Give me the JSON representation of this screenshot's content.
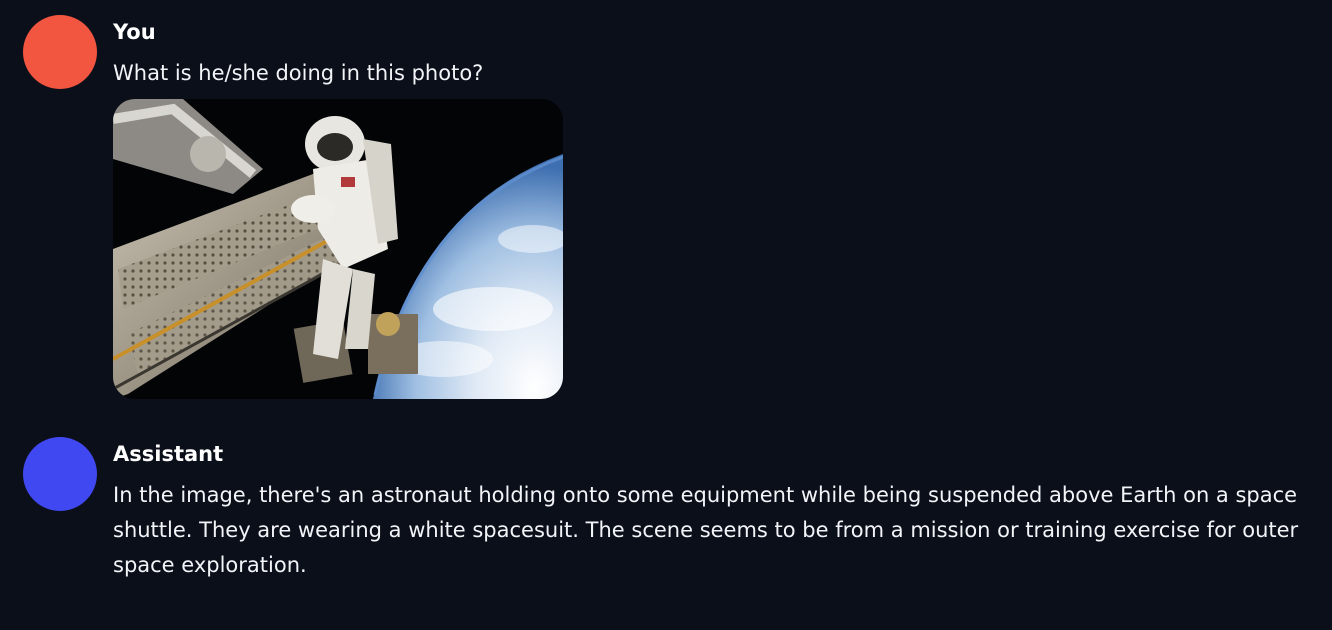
{
  "messages": [
    {
      "author": "You",
      "avatar_color": "#f25540",
      "text": "What is he/she doing in this photo?",
      "attachment": {
        "type": "image",
        "icon": "astronaut-spacewalk-photo"
      }
    },
    {
      "author": "Assistant",
      "avatar_color": "#4048f2",
      "text": "In the image, there's an astronaut holding onto some equipment while being suspended above Earth on a space shuttle. They are wearing a white spacesuit. The scene seems to be from a mission or training exercise for outer space exploration."
    }
  ]
}
